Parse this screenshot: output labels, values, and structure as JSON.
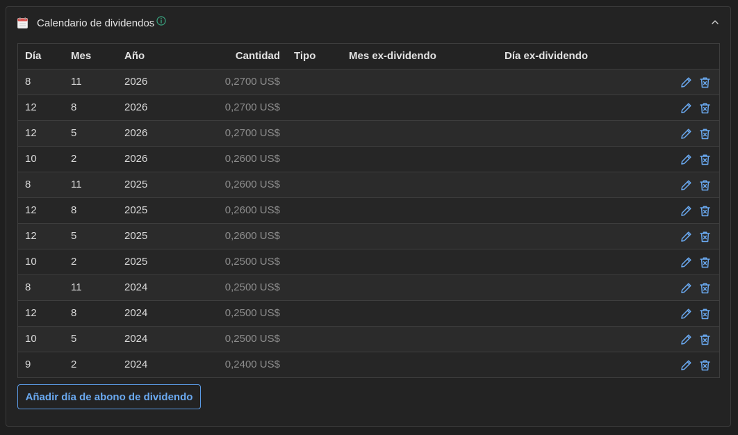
{
  "panel": {
    "title": "Calendario de dividendos",
    "icons": {
      "calendar": "calendar-icon",
      "info": "info-icon",
      "collapse": "chevron-up-icon",
      "edit": "pencil-icon",
      "delete": "trash-icon"
    },
    "colors": {
      "accent": "#5b9be6",
      "info": "#3aa883",
      "background": "#232323"
    }
  },
  "table": {
    "columns": {
      "dia": "Día",
      "mes": "Mes",
      "ano": "Año",
      "cantidad": "Cantidad",
      "tipo": "Tipo",
      "mes_ex": "Mes ex-dividendo",
      "dia_ex": "Día ex-dividendo"
    },
    "rows": [
      {
        "dia": "8",
        "mes": "11",
        "ano": "2026",
        "cantidad": "0,2700 US$",
        "tipo": "",
        "mes_ex": "",
        "dia_ex": ""
      },
      {
        "dia": "12",
        "mes": "8",
        "ano": "2026",
        "cantidad": "0,2700 US$",
        "tipo": "",
        "mes_ex": "",
        "dia_ex": ""
      },
      {
        "dia": "12",
        "mes": "5",
        "ano": "2026",
        "cantidad": "0,2700 US$",
        "tipo": "",
        "mes_ex": "",
        "dia_ex": ""
      },
      {
        "dia": "10",
        "mes": "2",
        "ano": "2026",
        "cantidad": "0,2600 US$",
        "tipo": "",
        "mes_ex": "",
        "dia_ex": ""
      },
      {
        "dia": "8",
        "mes": "11",
        "ano": "2025",
        "cantidad": "0,2600 US$",
        "tipo": "",
        "mes_ex": "",
        "dia_ex": ""
      },
      {
        "dia": "12",
        "mes": "8",
        "ano": "2025",
        "cantidad": "0,2600 US$",
        "tipo": "",
        "mes_ex": "",
        "dia_ex": ""
      },
      {
        "dia": "12",
        "mes": "5",
        "ano": "2025",
        "cantidad": "0,2600 US$",
        "tipo": "",
        "mes_ex": "",
        "dia_ex": ""
      },
      {
        "dia": "10",
        "mes": "2",
        "ano": "2025",
        "cantidad": "0,2500 US$",
        "tipo": "",
        "mes_ex": "",
        "dia_ex": ""
      },
      {
        "dia": "8",
        "mes": "11",
        "ano": "2024",
        "cantidad": "0,2500 US$",
        "tipo": "",
        "mes_ex": "",
        "dia_ex": ""
      },
      {
        "dia": "12",
        "mes": "8",
        "ano": "2024",
        "cantidad": "0,2500 US$",
        "tipo": "",
        "mes_ex": "",
        "dia_ex": ""
      },
      {
        "dia": "10",
        "mes": "5",
        "ano": "2024",
        "cantidad": "0,2500 US$",
        "tipo": "",
        "mes_ex": "",
        "dia_ex": ""
      },
      {
        "dia": "9",
        "mes": "2",
        "ano": "2024",
        "cantidad": "0,2400 US$",
        "tipo": "",
        "mes_ex": "",
        "dia_ex": ""
      }
    ]
  },
  "actions": {
    "add_label": "Añadir día de abono de dividendo"
  }
}
